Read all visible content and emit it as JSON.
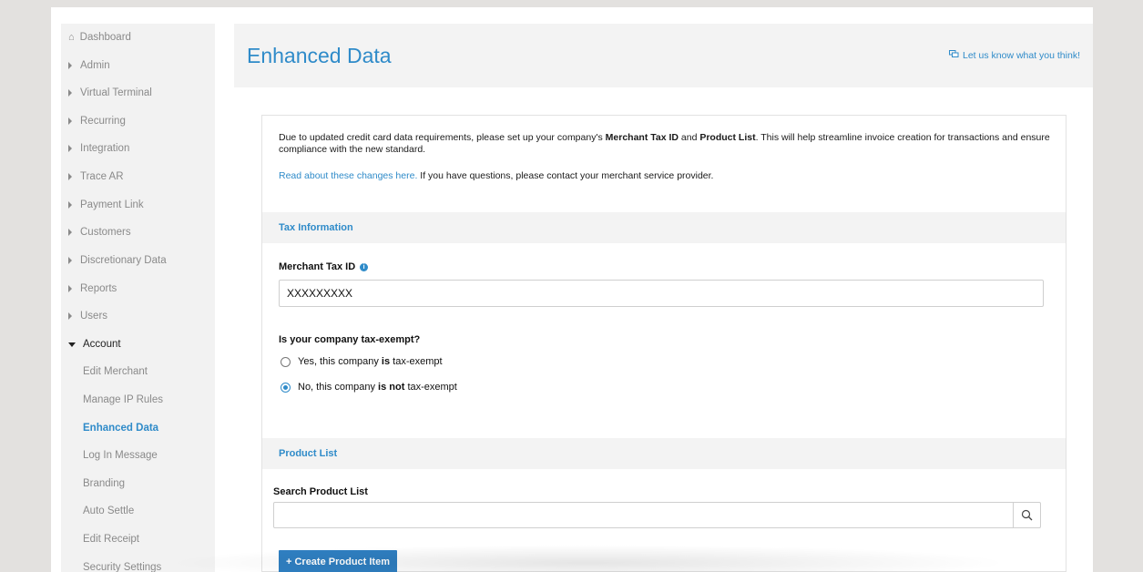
{
  "sidebar": {
    "dashboard": "Dashboard",
    "items": [
      {
        "label": "Admin"
      },
      {
        "label": "Virtual Terminal"
      },
      {
        "label": "Recurring"
      },
      {
        "label": "Integration"
      },
      {
        "label": "Trace AR"
      },
      {
        "label": "Payment Link"
      },
      {
        "label": "Customers"
      },
      {
        "label": "Discretionary Data"
      },
      {
        "label": "Reports"
      },
      {
        "label": "Users"
      }
    ],
    "open_item": "Account",
    "sub_items": [
      {
        "label": "Edit Merchant"
      },
      {
        "label": "Manage IP Rules"
      },
      {
        "label": "Enhanced Data"
      },
      {
        "label": "Log In Message"
      },
      {
        "label": "Branding"
      },
      {
        "label": "Auto Settle"
      },
      {
        "label": "Edit Receipt"
      },
      {
        "label": "Security Settings"
      }
    ]
  },
  "header": {
    "title": "Enhanced Data",
    "feedback_link": "Let us know what you think!"
  },
  "notice": {
    "part1": "Due to updated credit card data requirements, please set up your company's ",
    "bold1": "Merchant Tax ID",
    "part2": " and ",
    "bold2": "Product List",
    "part3": ". This will help streamline invoice creation for transactions and ensure compliance with the new standard.",
    "link_text": "Read about these changes here.",
    "after_link": " If you have questions, please contact your merchant service provider."
  },
  "tax_section": {
    "heading": "Tax Information",
    "merchant_tax_label": "Merchant Tax ID",
    "info_icon_glyph": "i",
    "merchant_tax_value": "XXXXXXXXX",
    "exempt_question": "Is your company tax-exempt?",
    "option_yes": {
      "prefix": "Yes, this company ",
      "bold": "is",
      "suffix": " tax-exempt",
      "checked": false
    },
    "option_no": {
      "prefix": "No, this company ",
      "bold": "is not",
      "suffix": " tax-exempt",
      "checked": true
    }
  },
  "product_section": {
    "heading": "Product List",
    "search_label": "Search Product List",
    "search_value": "",
    "create_button": "+ Create Product Item"
  },
  "colors": {
    "accent": "#2f8bc9",
    "button": "#2f7fc1",
    "background": "#e3e1df",
    "sidebar": "#f2f2f2",
    "section_bar": "#f3f3f3"
  },
  "icons": {
    "dashboard": "home-icon",
    "collapsed": "caret-right-icon",
    "expanded": "caret-down-icon",
    "feedback": "chat-icon",
    "info": "info-icon",
    "search": "search-icon"
  }
}
